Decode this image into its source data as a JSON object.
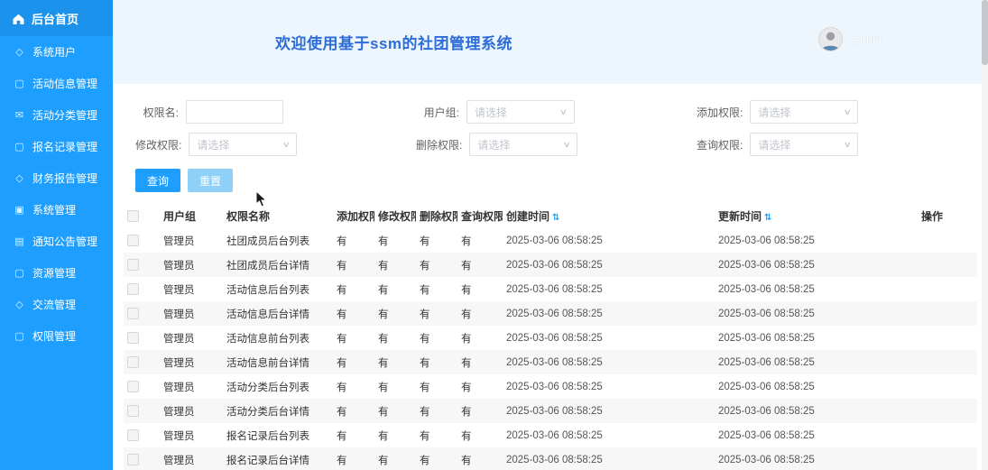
{
  "colors": {
    "accent": "#1e9fff",
    "sidebar_bg": "#1e9fff",
    "header_bg": "#eef6fd",
    "title": "#2b6cd9",
    "stripe": "#f7f7f7",
    "reset_btn": "#8ed0f8"
  },
  "sidebar": {
    "home_label": "后台首页",
    "items": [
      {
        "label": "系统用户",
        "icon": "◇",
        "icon_name": "diamond-icon"
      },
      {
        "label": "活动信息管理",
        "icon": "▢",
        "icon_name": "edit-icon"
      },
      {
        "label": "活动分类管理",
        "icon": "✉",
        "icon_name": "mail-icon"
      },
      {
        "label": "报名记录管理",
        "icon": "▢",
        "icon_name": "edit-icon"
      },
      {
        "label": "财务报告管理",
        "icon": "◇",
        "icon_name": "diamond-icon"
      },
      {
        "label": "系统管理",
        "icon": "▣",
        "icon_name": "checkbox-icon"
      },
      {
        "label": "通知公告管理",
        "icon": "▤",
        "icon_name": "document-icon"
      },
      {
        "label": "资源管理",
        "icon": "▢",
        "icon_name": "edit-icon"
      },
      {
        "label": "交流管理",
        "icon": "◇",
        "icon_name": "diamond-icon"
      },
      {
        "label": "权限管理",
        "icon": "▢",
        "icon_name": "edit-icon"
      }
    ]
  },
  "header": {
    "title": "欢迎使用基于ssm的社团管理系统",
    "username": "admin"
  },
  "filters": [
    {
      "name": "permission-name",
      "label": "权限名:",
      "type": "input",
      "value": "",
      "placeholder": ""
    },
    {
      "name": "user-group",
      "label": "用户组:",
      "type": "select",
      "value": "请选择"
    },
    {
      "name": "add-permission",
      "label": "添加权限:",
      "type": "select",
      "value": "请选择"
    },
    {
      "name": "modify-permission",
      "label": "修改权限:",
      "type": "select",
      "value": "请选择"
    },
    {
      "name": "delete-permission",
      "label": "删除权限:",
      "type": "select",
      "value": "请选择"
    },
    {
      "name": "query-permission",
      "label": "查询权限:",
      "type": "select",
      "value": "请选择"
    }
  ],
  "buttons": {
    "search": "查询",
    "reset": "重置"
  },
  "table": {
    "columns": [
      "用户组",
      "权限名称",
      "添加权限",
      "修改权限",
      "删除权限",
      "查询权限",
      "创建时间",
      "更新时间",
      "操作"
    ],
    "sortable_columns": [
      "创建时间",
      "更新时间"
    ],
    "sort_icon": "⇅",
    "rows": [
      {
        "group": "管理员",
        "name": "社团成员后台列表",
        "add": "有",
        "modify": "有",
        "del": "有",
        "query": "有",
        "created": "2025-03-06 08:58:25",
        "updated": "2025-03-06 08:58:25",
        "action": ""
      },
      {
        "group": "管理员",
        "name": "社团成员后台详情",
        "add": "有",
        "modify": "有",
        "del": "有",
        "query": "有",
        "created": "2025-03-06 08:58:25",
        "updated": "2025-03-06 08:58:25",
        "action": ""
      },
      {
        "group": "管理员",
        "name": "活动信息后台列表",
        "add": "有",
        "modify": "有",
        "del": "有",
        "query": "有",
        "created": "2025-03-06 08:58:25",
        "updated": "2025-03-06 08:58:25",
        "action": ""
      },
      {
        "group": "管理员",
        "name": "活动信息后台详情",
        "add": "有",
        "modify": "有",
        "del": "有",
        "query": "有",
        "created": "2025-03-06 08:58:25",
        "updated": "2025-03-06 08:58:25",
        "action": ""
      },
      {
        "group": "管理员",
        "name": "活动信息前台列表",
        "add": "有",
        "modify": "有",
        "del": "有",
        "query": "有",
        "created": "2025-03-06 08:58:25",
        "updated": "2025-03-06 08:58:25",
        "action": ""
      },
      {
        "group": "管理员",
        "name": "活动信息前台详情",
        "add": "有",
        "modify": "有",
        "del": "有",
        "query": "有",
        "created": "2025-03-06 08:58:25",
        "updated": "2025-03-06 08:58:25",
        "action": ""
      },
      {
        "group": "管理员",
        "name": "活动分类后台列表",
        "add": "有",
        "modify": "有",
        "del": "有",
        "query": "有",
        "created": "2025-03-06 08:58:25",
        "updated": "2025-03-06 08:58:25",
        "action": ""
      },
      {
        "group": "管理员",
        "name": "活动分类后台详情",
        "add": "有",
        "modify": "有",
        "del": "有",
        "query": "有",
        "created": "2025-03-06 08:58:25",
        "updated": "2025-03-06 08:58:25",
        "action": ""
      },
      {
        "group": "管理员",
        "name": "报名记录后台列表",
        "add": "有",
        "modify": "有",
        "del": "有",
        "query": "有",
        "created": "2025-03-06 08:58:25",
        "updated": "2025-03-06 08:58:25",
        "action": ""
      },
      {
        "group": "管理员",
        "name": "报名记录后台详情",
        "add": "有",
        "modify": "有",
        "del": "有",
        "query": "有",
        "created": "2025-03-06 08:58:25",
        "updated": "2025-03-06 08:58:25",
        "action": ""
      }
    ]
  }
}
